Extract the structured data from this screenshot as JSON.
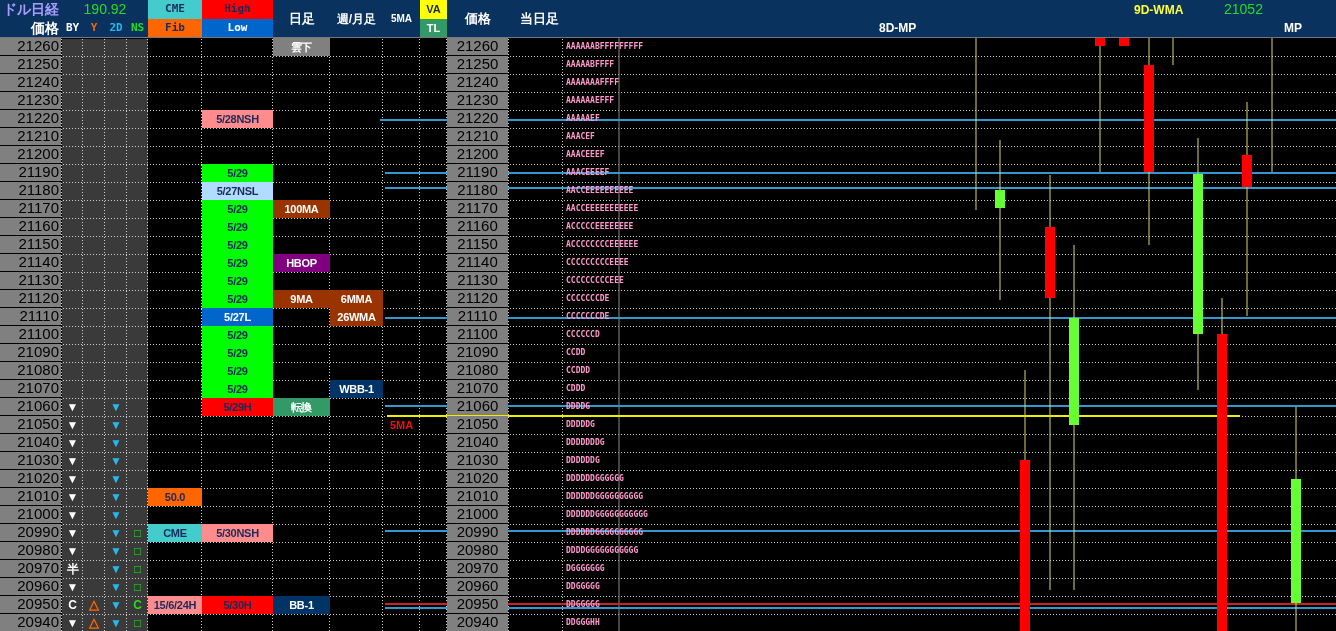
{
  "header": {
    "title": "ドル日経",
    "price": "価格",
    "rate": "190.92",
    "by": "BY",
    "y": "Y",
    "two_d": "2D",
    "ns": "NS",
    "cme": "CME",
    "fib": "Fib",
    "high": "High",
    "low": "Low",
    "daily": "日足",
    "weekly": "週/月足",
    "ma5": "5MA",
    "va": "VA",
    "tl": "TL",
    "profile_price": "価格",
    "today": "当日足",
    "mp_8d": "8D-MP",
    "wma_label": "9D-WMA",
    "wma_value": "21052",
    "mp": "MP"
  },
  "rows": [
    {
      "price": "21260",
      "daily": {
        "text": "雲下",
        "color": "#808080"
      },
      "profile_price": "21260",
      "profile": "AAAAAABFFFFFFFFF"
    },
    {
      "price": "21250",
      "profile_price": "21250",
      "profile": "AAAAABFFFF"
    },
    {
      "price": "21240",
      "profile_price": "21240",
      "profile": "AAAAAAAFFFF"
    },
    {
      "price": "21230",
      "profile_price": "21230",
      "profile": "AAAAAAEFFF"
    },
    {
      "price": "21220",
      "high_low": {
        "text": "5/28NSH",
        "color": "#ff8c8c"
      },
      "profile_price": "21220",
      "profile": "AAAAAEF"
    },
    {
      "price": "21210",
      "profile_price": "21210",
      "profile": "AAACEF"
    },
    {
      "price": "21200",
      "profile_price": "21200",
      "profile": "AAACEEEF"
    },
    {
      "price": "21190",
      "high_low": {
        "text": "5/29",
        "color": "#00ff00"
      },
      "profile_price": "21190",
      "profile": "AAACEEEEF"
    },
    {
      "price": "21180",
      "high_low": {
        "text": "5/27NSL",
        "color": "#b0dcff"
      },
      "profile_price": "21180",
      "profile": "AACCEEEEEEEEEE"
    },
    {
      "price": "21170",
      "high_low": {
        "text": "5/29",
        "color": "#00ff00"
      },
      "daily": {
        "text": "100MA",
        "color": "#993300"
      },
      "profile_price": "21170",
      "profile": "AACCEEEEEEEEEEE"
    },
    {
      "price": "21160",
      "high_low": {
        "text": "5/29",
        "color": "#00ff00"
      },
      "profile_price": "21160",
      "profile": "ACCCCCEEEEEEEE"
    },
    {
      "price": "21150",
      "high_low": {
        "text": "5/29",
        "color": "#00ff00"
      },
      "profile_price": "21150",
      "profile": "ACCCCCCCCEEEEEE"
    },
    {
      "price": "21140",
      "high_low": {
        "text": "5/29",
        "color": "#00ff00"
      },
      "daily": {
        "text": "HBOP",
        "color": "#800080"
      },
      "profile_price": "21140",
      "profile": "CCCCCCCCCEEEE"
    },
    {
      "price": "21130",
      "high_low": {
        "text": "5/29",
        "color": "#00ff00"
      },
      "profile_price": "21130",
      "profile": "CCCCCCCCCEEE"
    },
    {
      "price": "21120",
      "high_low": {
        "text": "5/29",
        "color": "#00ff00"
      },
      "daily": {
        "text": "9MA",
        "color": "#993300"
      },
      "weekly": {
        "text": "6MMA",
        "color": "#993300"
      },
      "profile_price": "21120",
      "profile": "CCCCCCCDE"
    },
    {
      "price": "21110",
      "high_low": {
        "text": "5/27L",
        "color": "#0066cc"
      },
      "weekly": {
        "text": "26WMA",
        "color": "#993300"
      },
      "profile_price": "21110",
      "profile": "CCCCCCCDE"
    },
    {
      "price": "21100",
      "high_low": {
        "text": "5/29",
        "color": "#00ff00"
      },
      "profile_price": "21100",
      "profile": "CCCCCCD"
    },
    {
      "price": "21090",
      "high_low": {
        "text": "5/29",
        "color": "#00ff00"
      },
      "profile_price": "21090",
      "profile": "CCDD"
    },
    {
      "price": "21080",
      "high_low": {
        "text": "5/29",
        "color": "#00ff00"
      },
      "profile_price": "21080",
      "profile": "CCDDD"
    },
    {
      "price": "21070",
      "high_low": {
        "text": "5/29",
        "color": "#00ff00"
      },
      "weekly": {
        "text": "WBB-1",
        "color": "#003366"
      },
      "profile_price": "21070",
      "profile": "CDDD"
    },
    {
      "price": "21060",
      "by": "▼",
      "two_d": "▼",
      "high_low": {
        "text": "5/29H",
        "color": "#ff0000"
      },
      "daily": {
        "text": "転換",
        "color": "#339966"
      },
      "profile_price": "21060",
      "profile": "DDDDG"
    },
    {
      "price": "21050",
      "by": "▼",
      "two_d": "▼",
      "ma5": "5MA",
      "profile_price": "21050",
      "profile": "DDDDDG"
    },
    {
      "price": "21040",
      "by": "▼",
      "two_d": "▼",
      "profile_price": "21040",
      "profile": "DDDDDDDG"
    },
    {
      "price": "21030",
      "by": "▼",
      "two_d": "▼",
      "profile_price": "21030",
      "profile": "DDDDDDG"
    },
    {
      "price": "21020",
      "by": "▼",
      "two_d": "▼",
      "profile_price": "21020",
      "profile": "DDDDDDGGGGGG"
    },
    {
      "price": "21010",
      "by": "▼",
      "two_d": "▼",
      "fib": {
        "text": "50.0",
        "color": "#ff6600"
      },
      "profile_price": "21010",
      "profile": "DDDDDDGGGGGGGGGG"
    },
    {
      "price": "21000",
      "by": "▼",
      "two_d": "▼",
      "profile_price": "21000",
      "profile": "DDDDDDGGGGGGGGGGG"
    },
    {
      "price": "20990",
      "by": "▼",
      "two_d": "▼",
      "ns": "□",
      "fib": {
        "text": "CME",
        "color": "#44cccc"
      },
      "high_low": {
        "text": "5/30NSH",
        "color": "#ff8c8c"
      },
      "profile_price": "20990",
      "profile": "DDDDDDGGGGGGGGGG"
    },
    {
      "price": "20980",
      "by": "▼",
      "two_d": "▼",
      "ns": "□",
      "profile_price": "20980",
      "profile": "DDDDGGGGGGGGGGG"
    },
    {
      "price": "20970",
      "by": "半",
      "two_d": "▼",
      "ns": "□",
      "profile_price": "20970",
      "profile": "DGGGGGGG"
    },
    {
      "price": "20960",
      "by": "▼",
      "two_d": "▼",
      "ns": "□",
      "profile_price": "20960",
      "profile": "DDGGGGG"
    },
    {
      "price": "20950",
      "by": "C",
      "y": "△",
      "two_d": "▼",
      "ns": "C",
      "fib": {
        "text": "15/6/24H",
        "color": "#ff8c8c"
      },
      "high_low": {
        "text": "5/30H",
        "color": "#ff0000"
      },
      "daily": {
        "text": "BB-1",
        "color": "#003366"
      },
      "profile_price": "20950",
      "profile": "DDGGGGG"
    },
    {
      "price": "20940",
      "by": "▼",
      "y": "△",
      "two_d": "▼",
      "ns": "□",
      "profile_price": "20940",
      "profile": "DDGGGHH"
    }
  ]
}
